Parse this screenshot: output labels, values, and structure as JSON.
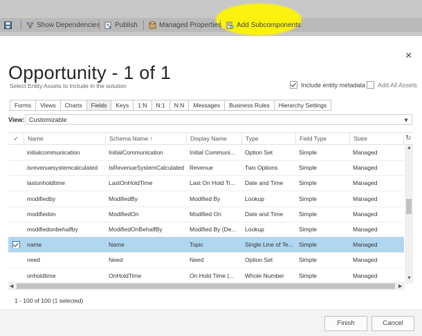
{
  "toolbar": {
    "items": [
      {
        "label": "",
        "icon": "save-icon"
      },
      {
        "label": "Show Dependencies",
        "icon": "dependencies-icon"
      },
      {
        "label": "Publish",
        "icon": "publish-icon"
      },
      {
        "label": "Managed Properties",
        "icon": "managed-properties-icon"
      },
      {
        "label": "Add Subcomponents",
        "icon": "add-subcomponents-icon"
      }
    ],
    "highlight_color": "#fff500"
  },
  "dialog": {
    "close_glyph": "×",
    "title": "Opportunity - 1 of 1",
    "subtitle": "Select Entity Assets to Include in the solution",
    "include_metadata": {
      "label": "Include entity metadata",
      "checked": true
    },
    "add_all_assets": {
      "label": "Add All Assets",
      "checked": false
    }
  },
  "tabs": [
    "Forms",
    "Views",
    "Charts",
    "Fields",
    "Keys",
    "1:N",
    "N:1",
    "N:N",
    "Messages",
    "Business Rules",
    "Hierarchy Settings"
  ],
  "active_tab": "Fields",
  "view": {
    "label": "View:",
    "value": "Customizable",
    "arrow": "▼"
  },
  "grid": {
    "check_glyph": "✓",
    "refresh_glyph": "↻",
    "columns": [
      "Name",
      "Schema Name ↑",
      "Display Name",
      "Type",
      "Field Type",
      "State"
    ],
    "rows": [
      {
        "name": "initialcommunication",
        "schema": "InitialCommunication",
        "display": "Initial Communi...",
        "type": "Option Set",
        "field_type": "Simple",
        "state": "Managed",
        "selected": false
      },
      {
        "name": "isrevenuesystemcalculated",
        "schema": "IsRevenueSystemCalculated",
        "display": "Revenue",
        "type": "Two Options",
        "field_type": "Simple",
        "state": "Managed",
        "selected": false
      },
      {
        "name": "lastonholdtime",
        "schema": "LastOnHoldTime",
        "display": "Last On Hold Ti...",
        "type": "Date and Time",
        "field_type": "Simple",
        "state": "Managed",
        "selected": false
      },
      {
        "name": "modifiedby",
        "schema": "ModifiedBy",
        "display": "Modified By",
        "type": "Lookup",
        "field_type": "Simple",
        "state": "Managed",
        "selected": false
      },
      {
        "name": "modifiedon",
        "schema": "ModifiedOn",
        "display": "Modified On",
        "type": "Date and Time",
        "field_type": "Simple",
        "state": "Managed",
        "selected": false
      },
      {
        "name": "modifiedonbehalfby",
        "schema": "ModifiedOnBehalfBy",
        "display": "Modified By (De...",
        "type": "Lookup",
        "field_type": "Simple",
        "state": "Managed",
        "selected": false
      },
      {
        "name": "name",
        "schema": "Name",
        "display": "Topic",
        "type": "Single Line of Te...",
        "field_type": "Simple",
        "state": "Managed",
        "selected": true
      },
      {
        "name": "need",
        "schema": "Need",
        "display": "Need",
        "type": "Option Set",
        "field_type": "Simple",
        "state": "Managed",
        "selected": false
      },
      {
        "name": "onholdtime",
        "schema": "OnHoldTime",
        "display": "On Hold Time (...",
        "type": "Whole Number",
        "field_type": "Simple",
        "state": "Managed",
        "selected": false
      }
    ],
    "selected_row_color": "#b1d6f0",
    "scroll_left": "◀",
    "scroll_right": "▶",
    "scroll_up": "▲",
    "scroll_down": "▼"
  },
  "record_count": "1 - 100 of 100 (1 selected)",
  "buttons": {
    "finish": "Finish",
    "cancel": "Cancel"
  }
}
